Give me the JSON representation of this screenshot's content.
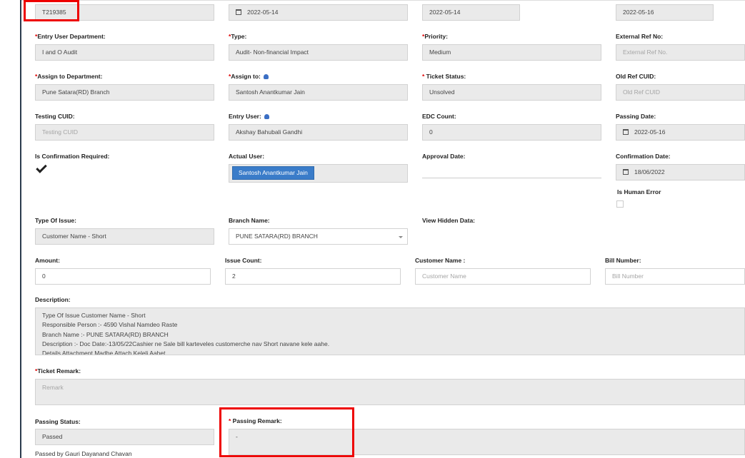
{
  "row0": {
    "ticket_no": "T219385",
    "date1": "2022-05-14",
    "date2": "2022-05-14",
    "date3": "2022-05-16"
  },
  "row1": {
    "entry_dept_label": "Entry User Department:",
    "entry_dept_value": "I and O Audit",
    "type_label": "Type:",
    "type_value": "Audit- Non-financial Impact",
    "priority_label": "Priority:",
    "priority_value": "Medium",
    "extref_label": "External Ref No:",
    "extref_placeholder": "External Ref No."
  },
  "row2": {
    "assign_dept_label": "Assign to Department:",
    "assign_dept_value": "Pune Satara(RD) Branch",
    "assign_to_label": "Assign to:",
    "assign_to_value": "Santosh Anantkumar Jain",
    "status_label": " Ticket Status:",
    "status_value": "Unsolved",
    "oldref_label": "Old Ref CUID:",
    "oldref_placeholder": "Old Ref CUID"
  },
  "row3": {
    "testing_label": "Testing CUID:",
    "testing_placeholder": "Testing CUID",
    "entry_user_label": "Entry User:",
    "entry_user_value": "Akshay Bahubali Gandhi",
    "edc_label": "EDC Count:",
    "edc_value": "0",
    "passing_date_label": "Passing Date:",
    "passing_date_value": "2022-05-16"
  },
  "row4": {
    "confirm_req_label": "Is Confirmation Required:",
    "actual_user_label": "Actual User:",
    "actual_user_tag": "Santosh Anantkumar Jain",
    "approval_label": "Approval Date:",
    "confirm_date_label": "Confirmation Date:",
    "confirm_date_value": "18/06/2022",
    "human_error_label": "Is Human Error"
  },
  "row5": {
    "issue_type_label": "Type Of Issue:",
    "issue_type_value": "Customer Name - Short",
    "branch_label": "Branch Name:",
    "branch_value": "PUNE SATARA(RD) BRANCH",
    "hidden_label": "View Hidden Data:"
  },
  "row6": {
    "amount_label": "Amount:",
    "amount_value": "0",
    "issue_count_label": "Issue Count:",
    "issue_count_value": "2",
    "cust_name_label": "Customer Name :",
    "cust_name_placeholder": "Customer Name",
    "bill_label": "Bill Number:",
    "bill_placeholder": "Bill Number"
  },
  "description": {
    "label": "Description:",
    "lines": [
      "Type Of Issue  Customer Name - Short",
      "Responsible Person :- 4590 Vishal Namdeo Raste",
      "Branch Name :- PUNE SATARA(RD) BRANCH",
      "Description :-  Doc Date:-13/05/22Cashier ne Sale bill karteveles customerche nav Short navane kele aahe.",
      "Details Attachment Madhe Attach Keleli Aahet"
    ]
  },
  "remark": {
    "label": "Ticket Remark:",
    "placeholder": "Remark"
  },
  "passing": {
    "status_label": "Passing Status:",
    "status_value": "Passed",
    "passed_by": "Passed by Gauri Dayanand Chavan",
    "remark_label": " Passing Remark:",
    "remark_value": "-"
  },
  "required_mark": "*",
  "colors": {
    "accent": "#3a7cc9",
    "highlight": "#ee0000"
  }
}
